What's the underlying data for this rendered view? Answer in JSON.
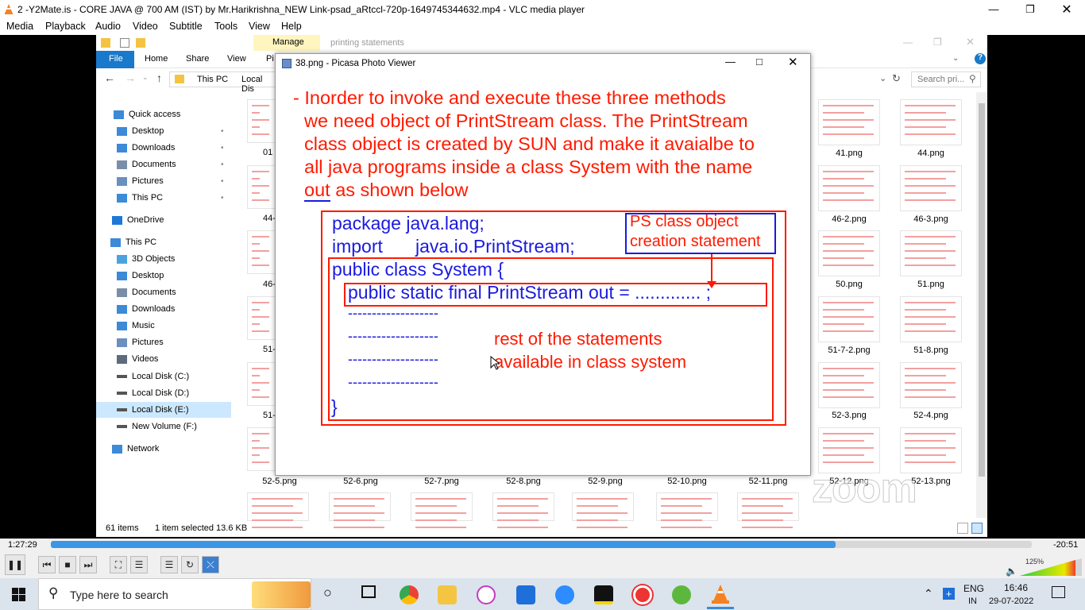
{
  "vlc": {
    "title": "2 -Y2Mate.is - CORE JAVA @ 700 AM (IST) by Mr.Harikrishna_NEW Link-psad_aRtccl-720p-1649745344632.mp4 - VLC media player",
    "menu": [
      "Media",
      "Playback",
      "Audio",
      "Video",
      "Subtitle",
      "Tools",
      "View",
      "Help"
    ],
    "time_elapsed": "1:27:29",
    "time_remaining": "-20:51",
    "progress": 0.8,
    "volume": "125%"
  },
  "explorer": {
    "ribbon_context_tab": "Manage",
    "ribbon_context_title": "printing statements",
    "tabs": [
      "File",
      "Home",
      "Share",
      "View",
      "Pi"
    ],
    "path": [
      "This PC",
      "Local Dis"
    ],
    "search_placeholder": "Search pri...",
    "sidebar": [
      {
        "label": "Quick access",
        "icon": "star-icon"
      },
      {
        "label": "Desktop",
        "icon": "desktop-icon"
      },
      {
        "label": "Downloads",
        "icon": "download-icon"
      },
      {
        "label": "Documents",
        "icon": "document-icon"
      },
      {
        "label": "Pictures",
        "icon": "pictures-icon"
      },
      {
        "label": "This PC",
        "icon": "pc-icon"
      },
      {
        "label": "OneDrive",
        "icon": "cloud-icon"
      },
      {
        "label": "This PC",
        "icon": "pc-icon"
      },
      {
        "label": "3D Objects",
        "icon": "cube-icon"
      },
      {
        "label": "Desktop",
        "icon": "desktop-icon"
      },
      {
        "label": "Documents",
        "icon": "document-icon"
      },
      {
        "label": "Downloads",
        "icon": "download-icon"
      },
      {
        "label": "Music",
        "icon": "music-icon"
      },
      {
        "label": "Pictures",
        "icon": "pictures-icon"
      },
      {
        "label": "Videos",
        "icon": "video-icon"
      },
      {
        "label": "Local Disk (C:)",
        "icon": "drive-icon"
      },
      {
        "label": "Local Disk (D:)",
        "icon": "drive-icon"
      },
      {
        "label": "Local Disk (E:)",
        "icon": "drive-icon"
      },
      {
        "label": "New Volume (F:)",
        "icon": "drive-icon"
      },
      {
        "label": "Network",
        "icon": "network-icon"
      }
    ],
    "left_partial_labels": [
      "01",
      "44-",
      "46-",
      "51-",
      "51-"
    ],
    "right_thumbs": [
      "41.png",
      "44.png",
      "46-2.png",
      "46-3.png",
      "50.png",
      "51.png",
      "51-7-2.png",
      "51-8.png",
      "52-3.png",
      "52-4.png",
      "52-12.png",
      "52-13.png"
    ],
    "bottom_labels": [
      "52-5.png",
      "52-6.png",
      "52-7.png",
      "52-8.png",
      "52-9.png",
      "52-10.png",
      "52-11.png"
    ],
    "status_count": "61 items",
    "status_selected": "1 item selected  13.6 KB"
  },
  "picasa": {
    "title": "38.png - Picasa Photo Viewer",
    "bullet_lines": [
      "- Inorder to invoke and execute these three methods",
      "we need object of PrintStream class. The PrintStream",
      "class object is created by SUN and make it avaialbe to",
      "all java programs inside a class System with the name"
    ],
    "last_line_word": "out",
    "last_line_rest": " as shown below",
    "code_line1": "package java.lang;",
    "code_line2_kw": "import",
    "code_line2": "java.io.PrintStream;",
    "ps_label_1": "PS class object",
    "ps_label_2": "creation statement",
    "code_class": "public  class System {",
    "code_field": "public static final PrintStream out = ............. ;",
    "dashes": "-------------------",
    "rest_1": "rest of the statements",
    "rest_2": "available in class system",
    "close_brace": "}"
  },
  "taskbar": {
    "search_placeholder": "Type here to search",
    "lang": "ENG",
    "region": "IN",
    "time": "16:46",
    "date": "29-07-2022"
  },
  "watermark": "zoom"
}
